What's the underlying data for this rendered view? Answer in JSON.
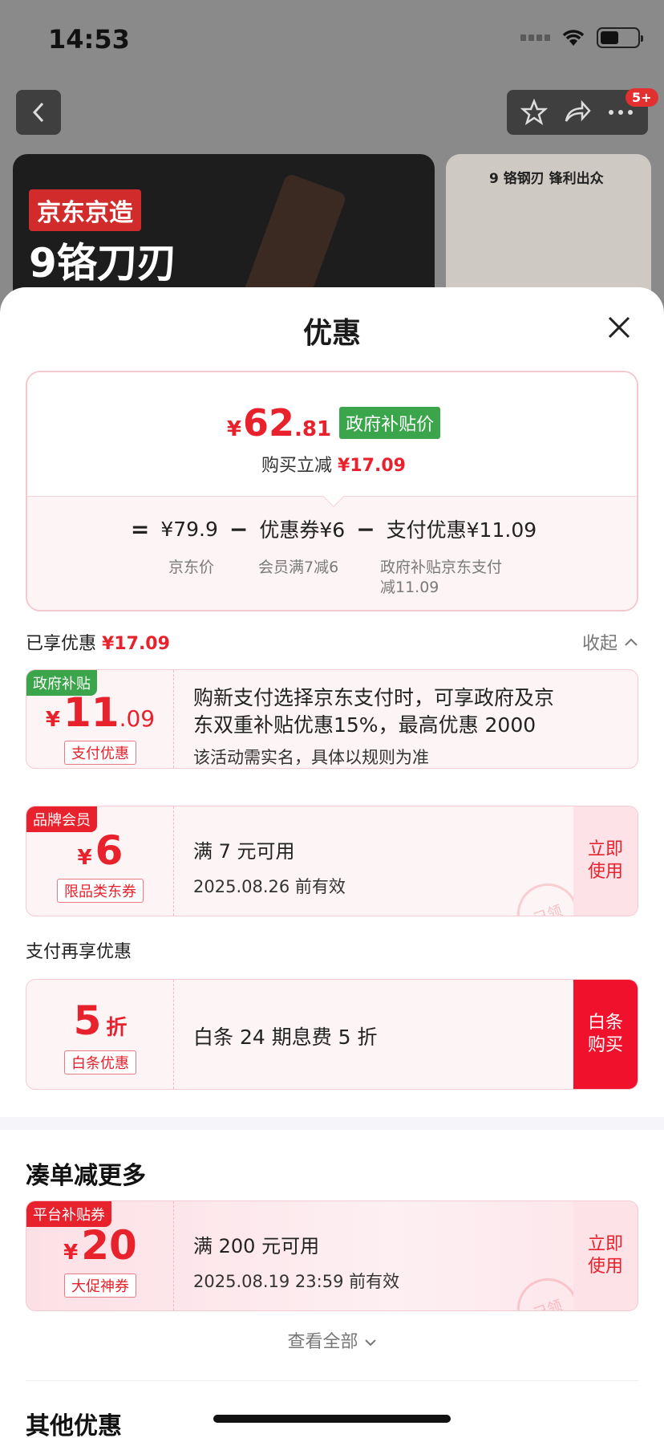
{
  "status": {
    "time": "14:53"
  },
  "background": {
    "cart_badge": "5+",
    "banner_tag": "京东京造",
    "banner_title": "9铬刀刃",
    "banner_right_text": "9 铬钢刃  锋利出众"
  },
  "sheet": {
    "title": "优惠",
    "price": {
      "yen": "¥",
      "integer": "62",
      "decimal": ".81",
      "tag": "政府补贴价",
      "reduce_label": "购买立减",
      "reduce_value": "¥17.09"
    },
    "formula": {
      "eq": "=",
      "base": "¥79.9",
      "base_sub": "京东价",
      "minus": "−",
      "coupon": "优惠券¥6",
      "coupon_sub": "会员满7减6",
      "pay": "支付优惠¥11.09",
      "pay_sub_1": "政府补贴京东支付",
      "pay_sub_2": "减11.09"
    },
    "enjoyed": {
      "label": "已享优惠",
      "value": "¥17.09",
      "collapse": "收起"
    },
    "coupons": [
      {
        "tag": "政府补贴",
        "yen": "¥",
        "amount": "11",
        "decimal": ".09",
        "kind": "支付优惠",
        "line1": "购新支付选择京东支付时，可享政府及京",
        "line2": "东双重补贴优惠15%，最高优惠 2000",
        "line3": "该活动需实名，具体以规则为准"
      },
      {
        "tag": "品牌会员",
        "yen": "¥",
        "amount": "6",
        "kind": "限品类东券",
        "line1": "满 7 元可用",
        "line2": "2025.08.26 前有效",
        "action_1": "立即",
        "action_2": "使用",
        "stamp": "已领"
      }
    ],
    "pay_more": {
      "label": "支付再享优惠",
      "amount": "5",
      "unit": "折",
      "kind": "白条优惠",
      "desc": "白条 24 期息费 5 折",
      "action_1": "白条",
      "action_2": "购买"
    },
    "more": {
      "title": "凑单减更多",
      "tag": "平台补贴券",
      "yen": "¥",
      "amount": "20",
      "kind": "大促神券",
      "line1": "满 200 元可用",
      "line2": "2025.08.19 23:59 前有效",
      "action_1": "立即",
      "action_2": "使用",
      "stamp": "已领",
      "view_all": "查看全部"
    },
    "other": {
      "title": "其他优惠"
    }
  }
}
